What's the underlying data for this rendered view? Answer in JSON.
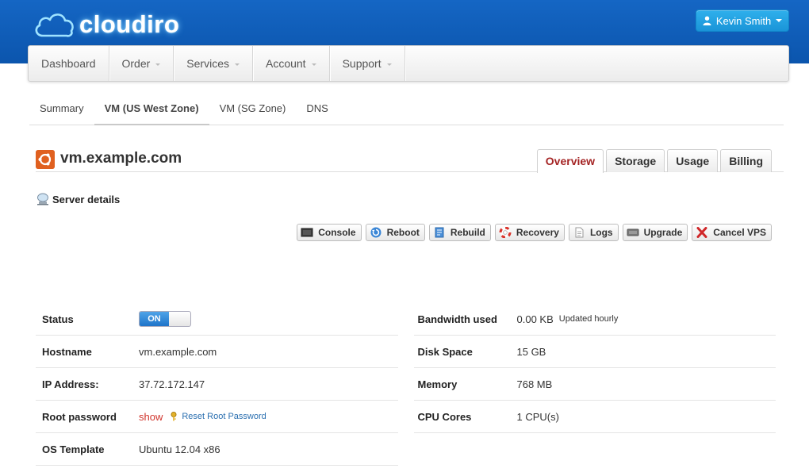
{
  "brand": {
    "name": "cloudiro"
  },
  "user": {
    "name": "Kevin Smith"
  },
  "nav": [
    {
      "label": "Dashboard",
      "dropdown": false
    },
    {
      "label": "Order",
      "dropdown": true
    },
    {
      "label": "Services",
      "dropdown": true
    },
    {
      "label": "Account",
      "dropdown": true
    },
    {
      "label": "Support",
      "dropdown": true
    }
  ],
  "subtabs": [
    {
      "label": "Summary",
      "active": false
    },
    {
      "label": "VM (US West Zone)",
      "active": true
    },
    {
      "label": "VM (SG Zone)",
      "active": false
    },
    {
      "label": "DNS",
      "active": false
    }
  ],
  "vm": {
    "hostname_title": "vm.example.com",
    "os_icon": "ubuntu-icon",
    "tabs": [
      {
        "label": "Overview",
        "active": true
      },
      {
        "label": "Storage",
        "active": false
      },
      {
        "label": "Usage",
        "active": false
      },
      {
        "label": "Billing",
        "active": false
      }
    ]
  },
  "section": {
    "title": "Server details",
    "icon": "server-icon"
  },
  "actions": [
    {
      "label": "Console",
      "icon": "console-icon"
    },
    {
      "label": "Reboot",
      "icon": "reboot-icon"
    },
    {
      "label": "Rebuild",
      "icon": "rebuild-icon"
    },
    {
      "label": "Recovery",
      "icon": "lifebuoy-icon"
    },
    {
      "label": "Logs",
      "icon": "document-icon"
    },
    {
      "label": "Upgrade",
      "icon": "upgrade-icon"
    },
    {
      "label": "Cancel VPS",
      "icon": "cancel-icon"
    }
  ],
  "details_left": {
    "status": {
      "label": "Status",
      "toggle": "ON"
    },
    "hostname": {
      "label": "Hostname",
      "value": "vm.example.com"
    },
    "ip": {
      "label": "IP Address:",
      "value": "37.72.172.147"
    },
    "root_password": {
      "label": "Root password",
      "show": "show",
      "reset": "Reset Root Password"
    },
    "os": {
      "label": "OS Template",
      "value": "Ubuntu 12.04 x86"
    }
  },
  "details_right": {
    "bandwidth": {
      "label": "Bandwidth used",
      "value": "0.00 KB",
      "note": "Updated hourly"
    },
    "disk": {
      "label": "Disk Space",
      "value": "15 GB"
    },
    "memory": {
      "label": "Memory",
      "value": "768 MB"
    },
    "cpu": {
      "label": "CPU Cores",
      "value": "1 CPU(s)"
    }
  },
  "colors": {
    "header_blue": "#0b55ad",
    "user_button": "#1a94d8",
    "active_tab_text": "#a42323",
    "toggle_on": "#1f74c9",
    "link_red": "#d0342c",
    "link_blue": "#2a6fb0"
  }
}
